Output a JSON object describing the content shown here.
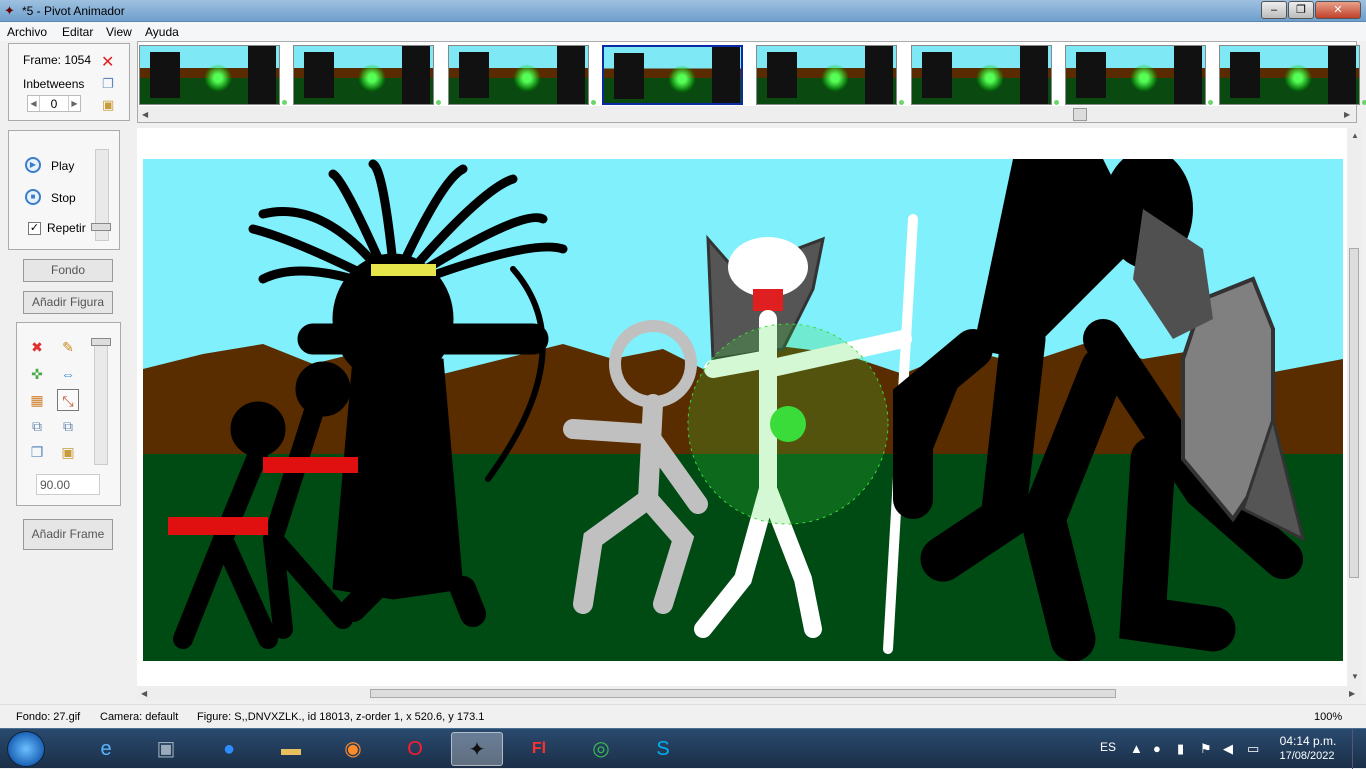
{
  "window": {
    "title": "*5 - Pivot Animador",
    "minimize": "–",
    "maximize": "❐",
    "close": "✕"
  },
  "menu": [
    "Archivo",
    "Editar",
    "View",
    "Ayuda"
  ],
  "frame_panel": {
    "frame_label": "Frame: 1054",
    "inbetweens_label": "Inbetweens",
    "inbetweens_value": "0"
  },
  "playback": {
    "play_label": "Play",
    "stop_label": "Stop",
    "repeat_label": "Repetir",
    "repeat_checked": true
  },
  "buttons": {
    "fondo": "Fondo",
    "add_figure": "Añadir Figura",
    "add_frame": "Añadir Frame"
  },
  "tools": {
    "angle_value": "90.00",
    "icons": [
      "delete-icon",
      "pencil-icon",
      "center-icon",
      "flip-icon",
      "color-icon",
      "scale-icon",
      "lower-icon",
      "raise-icon",
      "copy-icon",
      "paste-icon"
    ]
  },
  "filmstrip": {
    "thumbnail_count": 8,
    "selected_index": 3
  },
  "status": {
    "fondo": "Fondo: 27.gif",
    "camera": "Camera: default",
    "figure": "Figure: S,,DNVXZLK.,  id 18013,  z-order 1,  x 520.6, y 173.1",
    "zoom": "100%"
  },
  "taskbar": {
    "apps": [
      "ie-icon",
      "explorer-icon",
      "zoom-icon",
      "folder-icon",
      "firefox-icon",
      "opera-icon",
      "pivot-icon",
      "flash-icon",
      "chrome-icon",
      "skype-icon"
    ],
    "active_app": "pivot-icon",
    "lang": "ES",
    "time": "04:14 p.m.",
    "date": "17/08/2022"
  },
  "colors": {
    "sky": "#7ff0fc",
    "ground": "#004a14",
    "mountains": "#5a2d00",
    "title_bar": "#8fb3d9",
    "selection": "#0a2aa8"
  }
}
